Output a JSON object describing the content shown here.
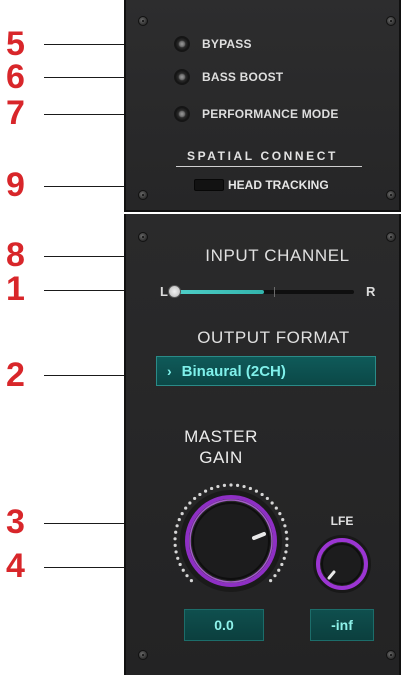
{
  "callouts": [
    "5",
    "6",
    "7",
    "9",
    "8",
    "1",
    "2",
    "3",
    "4"
  ],
  "top_panel": {
    "options": [
      {
        "label": "BYPASS"
      },
      {
        "label": "BASS BOOST"
      },
      {
        "label": "PERFORMANCE MODE"
      }
    ],
    "section_heading": "SPATIAL CONNECT",
    "head_tracking_label": "HEAD TRACKING"
  },
  "bottom_panel": {
    "input_channel_label": "INPUT CHANNEL",
    "slider": {
      "left_label": "L",
      "right_label": "R",
      "value_fraction": 0.5,
      "handle_fraction": 0.0
    },
    "output_format_label": "OUTPUT FORMAT",
    "output_format": {
      "chevron": "›",
      "value": "Binaural (2CH)"
    },
    "master_gain": {
      "label_line1": "MASTER",
      "label_line2": "GAIN",
      "value": "0.0"
    },
    "lfe": {
      "label": "LFE",
      "value": "-inf"
    }
  },
  "colors": {
    "accent_teal": "#4fcfc8",
    "knob_ring_purple": "#a03ad6",
    "callout_red": "#d8262a"
  }
}
